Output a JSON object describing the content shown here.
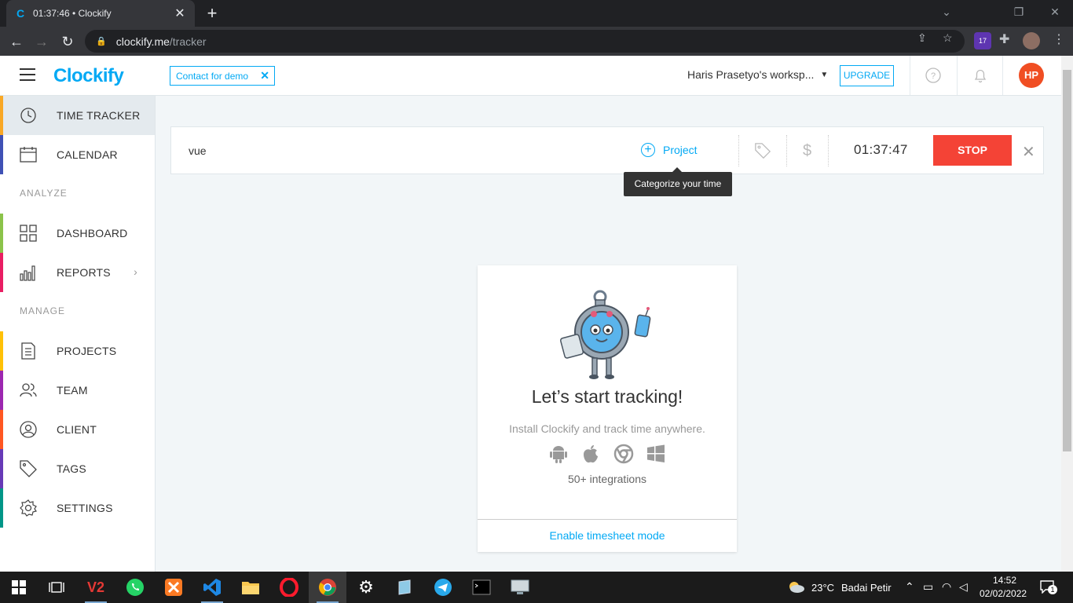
{
  "browser": {
    "tab_title": "01:37:46 • Clockify",
    "url_host": "clockify.me",
    "url_path": "/tracker",
    "extension_badge": "17"
  },
  "header": {
    "logo": "Clockify",
    "contact_demo": "Contact for demo",
    "workspace": "Haris Prasetyo's worksp...",
    "upgrade": "UPGRADE",
    "avatar_initials": "HP",
    "avatar_color": "#f04e23"
  },
  "sidebar": {
    "items": [
      {
        "label": "TIME TRACKER",
        "color": "#f9a825"
      },
      {
        "label": "CALENDAR",
        "color": "#3f51b5"
      },
      {
        "label": "DASHBOARD",
        "color": "#8bc34a"
      },
      {
        "label": "REPORTS",
        "color": "#e91e63"
      },
      {
        "label": "PROJECTS",
        "color": "#ffc107"
      },
      {
        "label": "TEAM",
        "color": "#9c27b0"
      },
      {
        "label": "CLIENT",
        "color": "#ff5722"
      },
      {
        "label": "TAGS",
        "color": "#673ab7"
      },
      {
        "label": "SETTINGS",
        "color": "#009688"
      }
    ],
    "section_analyze": "ANALYZE",
    "section_manage": "MANAGE"
  },
  "timer": {
    "description": "vue",
    "project_label": "Project",
    "elapsed": "01:37:47",
    "stop_label": "STOP",
    "tooltip": "Categorize your time"
  },
  "empty_state": {
    "title": "Let’s start tracking!",
    "subtitle": "Install Clockify and track time anywhere.",
    "platforms": [
      "android-icon",
      "apple-icon",
      "chrome-icon",
      "windows-icon"
    ],
    "integrations": "50+ integrations",
    "timesheet_link": "Enable timesheet mode"
  },
  "taskbar": {
    "weather_temp": "23°C",
    "weather_desc": "Badai Petir",
    "time": "14:52",
    "date": "02/02/2022",
    "notifications": "1"
  },
  "colors": {
    "brand": "#03a9f4",
    "stop": "#f44336"
  }
}
